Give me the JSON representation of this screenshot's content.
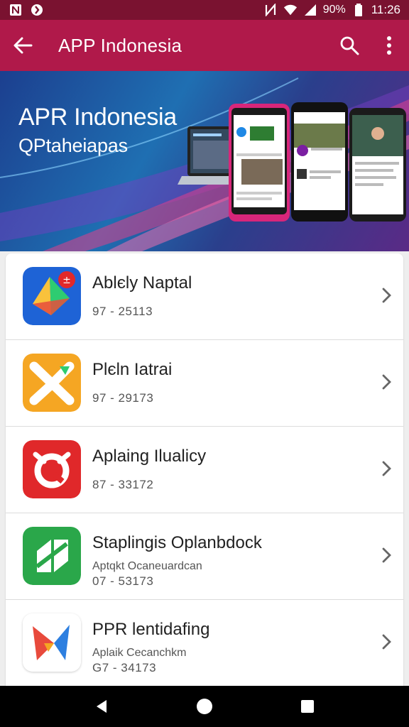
{
  "status_bar": {
    "battery": "90%",
    "time": "11:26",
    "icons": [
      "notification-icon",
      "sync-icon",
      "nfc-icon",
      "wifi-icon",
      "signal-icon",
      "battery-icon"
    ]
  },
  "app_bar": {
    "title": "APP Indonesia",
    "icons": [
      "back-arrow-icon",
      "search-icon",
      "more-vert-icon"
    ]
  },
  "banner": {
    "title": "APR Indonesia",
    "subtitle": "QPtaheiapas"
  },
  "apps": [
    {
      "name": "Ablєly Naptal",
      "subtitle": "",
      "code": "97 - 25113",
      "color": "#1e63d6",
      "icon": "app-icon-1"
    },
    {
      "name": "Plєln Iatrai",
      "subtitle": "",
      "code": "97 - 29173",
      "color": "#f5a623",
      "icon": "app-icon-2"
    },
    {
      "name": "Aplaing Ilualicy",
      "subtitle": "",
      "code": "87 - 33172",
      "color": "#e0282a",
      "icon": "app-icon-3"
    },
    {
      "name": "Staplingis Oplanbdock",
      "subtitle": "Aptqkt Ocaneuardcan",
      "code": "07 - 53173",
      "color": "#2aa74a",
      "icon": "app-icon-4"
    },
    {
      "name": "PPR lentidafing",
      "subtitle": "Aplaik Cecanchkm",
      "code": "G7 - 34173",
      "color": "#ffffff",
      "icon": "app-icon-5"
    }
  ],
  "nav": {
    "icons": [
      "nav-back-icon",
      "nav-home-icon",
      "nav-recents-icon"
    ]
  },
  "colors": {
    "status_bar": "#7a1230",
    "app_bar": "#b0194a",
    "nav_bar": "#000000"
  }
}
